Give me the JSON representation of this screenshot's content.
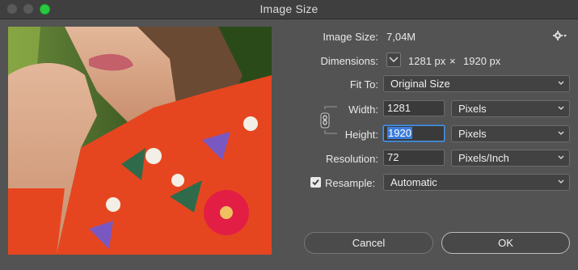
{
  "window": {
    "title": "Image Size"
  },
  "info": {
    "image_size_label": "Image Size:",
    "image_size_value": "7,04M",
    "dimensions_label": "Dimensions:",
    "dim_width": "1281 px",
    "dim_times": "×",
    "dim_height": "1920 px",
    "fit_to_label": "Fit To:",
    "fit_to_value": "Original Size"
  },
  "fields": {
    "width_label": "Width:",
    "width_value": "1281",
    "width_unit": "Pixels",
    "height_label": "Height:",
    "height_value": "1920",
    "height_unit": "Pixels",
    "resolution_label": "Resolution:",
    "resolution_value": "72",
    "resolution_unit": "Pixels/Inch",
    "resample_label": "Resample:",
    "resample_value": "Automatic",
    "resample_checked": true
  },
  "buttons": {
    "cancel": "Cancel",
    "ok": "OK"
  },
  "icons": {
    "settings": "gear-icon",
    "dimensions_toggle": "chevron-down-icon",
    "constrain": "chain-link-icon",
    "checkmark": "checkmark-icon"
  },
  "colors": {
    "focus": "#4d93d8",
    "zoom": "#2ac840"
  }
}
